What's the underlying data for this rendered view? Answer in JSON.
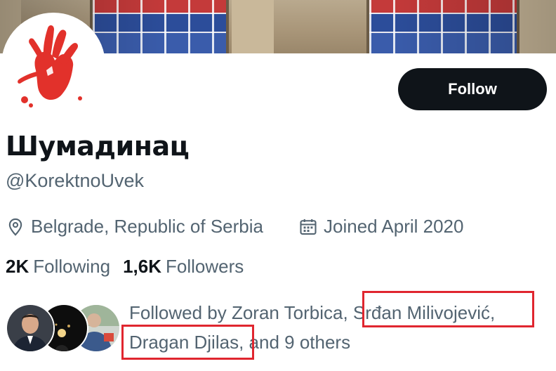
{
  "profile": {
    "display_name": "Шумадинац",
    "handle": "@KorektnoUvek",
    "location": "Belgrade, Republic of Serbia",
    "joined": "Joined April 2020",
    "avatar_icon": "red-handprint-icon"
  },
  "actions": {
    "follow_label": "Follow"
  },
  "stats": {
    "following_count": "2K",
    "following_label": "Following",
    "followers_count": "1,6K",
    "followers_label": "Followers"
  },
  "followed_by": {
    "prefix": "Followed by Zoran Torbica,",
    "name_1": "Srđan Milivojević,",
    "name_2": "Dragan Djilas,",
    "suffix": "and 9 others"
  },
  "icons": {
    "location": "map-pin-icon",
    "calendar": "calendar-icon"
  },
  "colors": {
    "button_bg": "#0f1419",
    "secondary_text": "#536471",
    "highlight_box": "#e0262f",
    "hand": "#e2312b"
  }
}
